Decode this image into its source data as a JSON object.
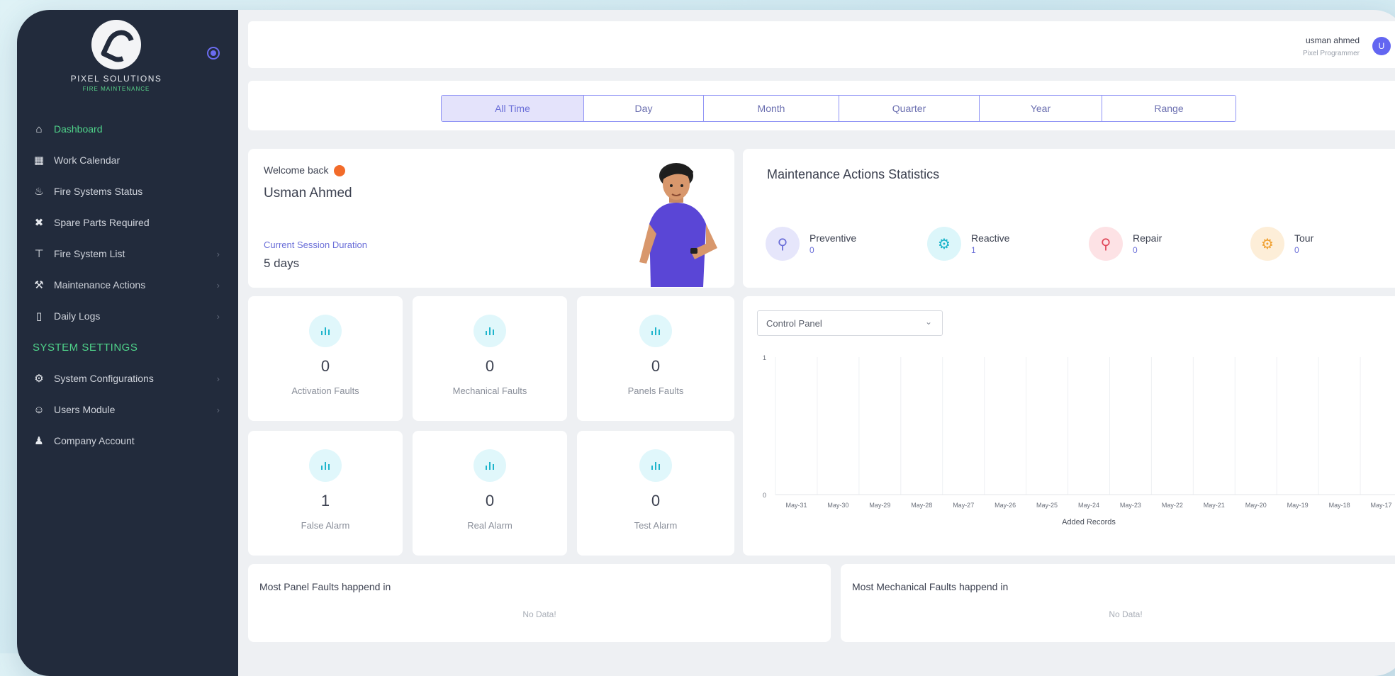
{
  "brand": {
    "name": "PIXEL SOLUTIONS",
    "tagline": "FIRE MAINTENANCE"
  },
  "sidebar": {
    "items": [
      {
        "label": "Dashboard",
        "icon": "home-icon",
        "active": true
      },
      {
        "label": "Work Calendar",
        "icon": "calendar-icon"
      },
      {
        "label": "Fire Systems Status",
        "icon": "flame-icon"
      },
      {
        "label": "Spare Parts Required",
        "icon": "tools-icon"
      },
      {
        "label": "Fire System List",
        "icon": "extinguisher-icon",
        "chevron": true
      },
      {
        "label": "Maintenance Actions",
        "icon": "wrench-icon",
        "chevron": true
      },
      {
        "label": "Daily Logs",
        "icon": "clipboard-icon",
        "chevron": true
      }
    ],
    "section_title": "SYSTEM SETTINGS",
    "settings_items": [
      {
        "label": "System Configurations",
        "icon": "settings-icon",
        "chevron": true
      },
      {
        "label": "Users Module",
        "icon": "users-icon",
        "chevron": true
      },
      {
        "label": "Company Account",
        "icon": "company-icon"
      }
    ]
  },
  "header": {
    "user_name": "usman ahmed",
    "user_role": "Pixel Programmer",
    "avatar_initial": "U"
  },
  "filters": {
    "tabs": [
      "All Time",
      "Day",
      "Month",
      "Quarter",
      "Year",
      "Range"
    ],
    "active": "All Time"
  },
  "welcome": {
    "greeting": "Welcome back",
    "name": "Usman Ahmed",
    "session_label": "Current Session Duration",
    "session_value": "5 days"
  },
  "maintenance_stats": {
    "title": "Maintenance Actions Statistics",
    "items": [
      {
        "label": "Preventive",
        "value": "0",
        "color": "#6a6ed8",
        "bg": "#e6e6fb",
        "icon": "search-gear-icon"
      },
      {
        "label": "Reactive",
        "value": "1",
        "color": "#19b3c9",
        "bg": "#dcf6fa",
        "icon": "gear-icon"
      },
      {
        "label": "Repair",
        "value": "0",
        "color": "#e0485a",
        "bg": "#fde2e5",
        "icon": "search-icon"
      },
      {
        "label": "Tour",
        "value": "0",
        "color": "#f0a030",
        "bg": "#fdeed8",
        "icon": "gear-icon"
      }
    ]
  },
  "faults": [
    {
      "value": "0",
      "label": "Activation Faults"
    },
    {
      "value": "0",
      "label": "Mechanical Faults"
    },
    {
      "value": "0",
      "label": "Panels Faults"
    },
    {
      "value": "1",
      "label": "False Alarm"
    },
    {
      "value": "0",
      "label": "Real Alarm"
    },
    {
      "value": "0",
      "label": "Test Alarm"
    }
  ],
  "chart_panel": {
    "dropdown_value": "Control Panel"
  },
  "chart_data": {
    "type": "bar",
    "categories": [
      "May-31",
      "May-30",
      "May-29",
      "May-28",
      "May-27",
      "May-26",
      "May-25",
      "May-24",
      "May-23",
      "May-22",
      "May-21",
      "May-20",
      "May-19",
      "May-18",
      "May-17"
    ],
    "values": [
      0,
      0,
      0,
      0,
      0,
      0,
      0,
      0,
      0,
      0,
      0,
      0,
      0,
      0,
      0
    ],
    "xlabel": "Added Records",
    "ylim": [
      0,
      1
    ],
    "yticks": [
      "1",
      "0"
    ]
  },
  "bottom_cards": [
    {
      "title": "Most Panel Faults happend in",
      "empty_text": "No Data!"
    },
    {
      "title": "Most Mechanical Faults happend in",
      "empty_text": "No Data!"
    }
  ]
}
